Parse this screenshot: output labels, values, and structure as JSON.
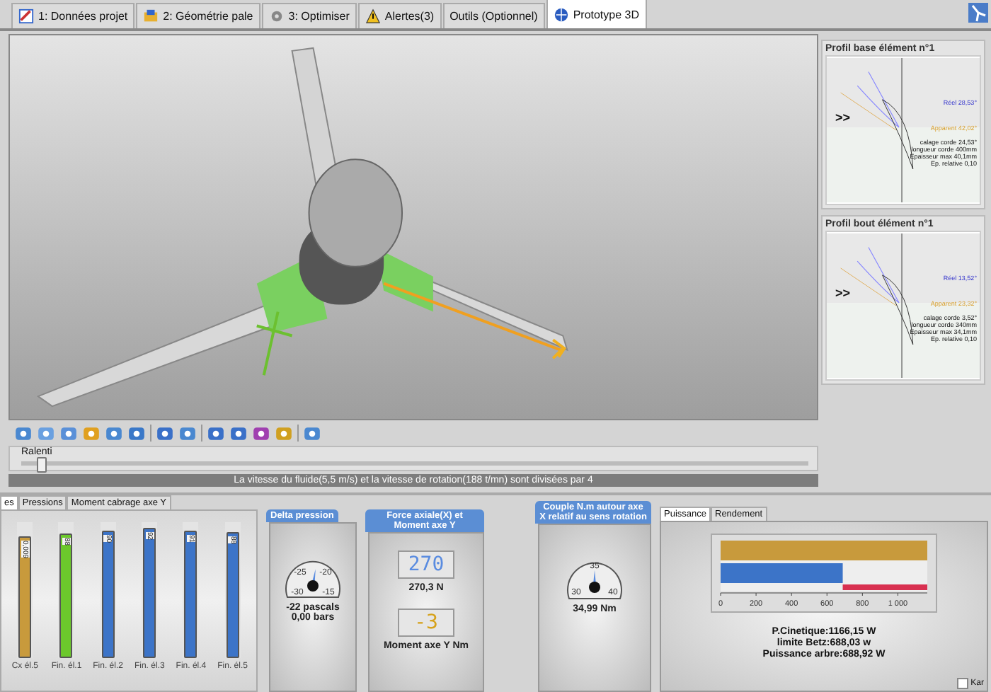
{
  "tabs": [
    {
      "label": "1: Données projet",
      "selected": false
    },
    {
      "label": "2: Géométrie pale",
      "selected": false
    },
    {
      "label": "3: Optimiser",
      "selected": false
    },
    {
      "label": "Alertes(3)",
      "selected": false
    },
    {
      "label": "Outils (Optionnel)",
      "selected": false
    },
    {
      "label": "Prototype 3D",
      "selected": true
    }
  ],
  "profiles": [
    {
      "title": "Profil base élément n°1",
      "marker": ">>",
      "real": "Réel 28,53°",
      "apparent": "Apparent 42,02°",
      "notes": [
        "calage corde 24,53°",
        "longueur corde 400mm",
        "Epaisseur max 40,1mm",
        "Ep. relative 0,10"
      ]
    },
    {
      "title": "Profil bout élément n°1",
      "marker": ">>",
      "real": "Réel 13,52°",
      "apparent": "Apparent 23,32°",
      "notes": [
        "calage corde 3,52°",
        "longueur corde 340mm",
        "Epaisseur max 34,1mm",
        "Ep. relative 0,10"
      ]
    }
  ],
  "slider": {
    "label": "Ralenti",
    "level": 0.02
  },
  "status": "La vitesse du fluide(5,5 m/s) et la vitesse de rotation(188 t/mn) sont divisées par 4",
  "chart_tabs": [
    {
      "label": "es",
      "selected": true
    },
    {
      "label": "Pressions",
      "selected": false
    },
    {
      "label": "Moment cabrage axe Y",
      "selected": false
    }
  ],
  "bars": [
    {
      "label": "Cx él.5",
      "value": "0,009",
      "level": 0.9,
      "color": "#c89a3c"
    },
    {
      "label": "Fin. él.1",
      "value": "88",
      "level": 0.92,
      "color": "#6cc82c"
    },
    {
      "label": "Fin. él.2",
      "value": "90",
      "level": 0.94,
      "color": "#3c74c8"
    },
    {
      "label": "Fin. él.3",
      "value": "92",
      "level": 0.96,
      "color": "#3c74c8"
    },
    {
      "label": "Fin. él.4",
      "value": "91",
      "level": 0.94,
      "color": "#3c74c8"
    },
    {
      "label": "Fin. él.5",
      "value": "88",
      "level": 0.93,
      "color": "#3c74c8"
    }
  ],
  "delta_pression": {
    "title": "Delta pression",
    "ticks": [
      "-25",
      "-20",
      "-30",
      "-15"
    ],
    "level": 0.55,
    "readings": [
      "-22 pascals",
      "0,00 bars"
    ]
  },
  "force": {
    "title": "Force axiale(X) et Moment axe Y",
    "display_1": "270",
    "reading_1": "270,3 N",
    "display_2": "-3",
    "reading_2": "Moment axe Y Nm"
  },
  "couple": {
    "title": "Couple N.m autour axe X relatif au sens rotation",
    "ticks": [
      "30",
      "35",
      "40"
    ],
    "level": 0.5,
    "reading": "34,99 Nm"
  },
  "power_tabs": [
    {
      "label": "Puissance",
      "selected": true
    },
    {
      "label": "Rendement",
      "selected": false
    }
  ],
  "power": {
    "chart_data": {
      "type": "bar",
      "orientation": "horizontal",
      "series": [
        {
          "color": "#c89a3c",
          "values": [
            1166
          ]
        },
        {
          "color": "#3c74c8",
          "values": [
            689
          ]
        }
      ],
      "xlim": [
        0,
        1166
      ],
      "xticks": [
        0,
        200,
        400,
        600,
        800,
        {
          "value": 1000,
          "label": "1 000"
        }
      ]
    },
    "lines": [
      "P.Cinetique:1166,15 W",
      "limite Betz:688,03 w",
      "Puissance arbre:688,92 W"
    ],
    "checkbox": {
      "label": "Kar",
      "checked": false
    }
  }
}
